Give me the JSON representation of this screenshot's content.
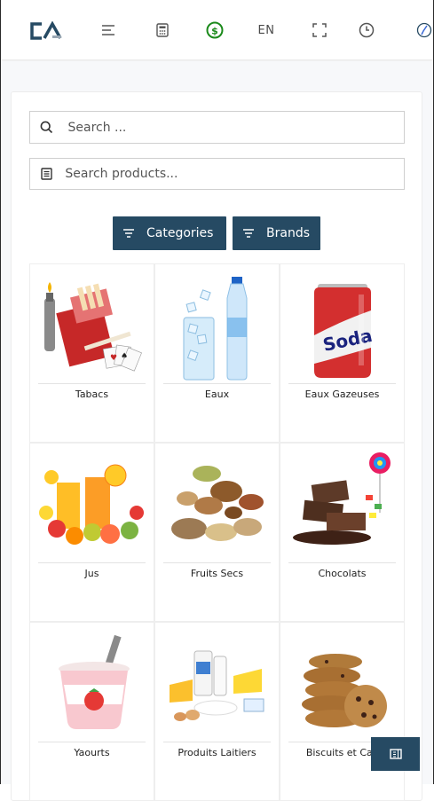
{
  "header": {
    "logo_text": "CA",
    "icons": [
      "menu-icon",
      "calculator-icon",
      "currency-icon",
      "fullscreen-icon",
      "clock-icon",
      "compass-icon"
    ],
    "language": "EN",
    "currency_color": "#1b8a1b"
  },
  "search": {
    "main_placeholder": "Search ...",
    "products_placeholder": "Search products..."
  },
  "filters": {
    "categories_label": "Categories",
    "brands_label": "Brands",
    "button_color": "#264a63"
  },
  "categories": [
    {
      "label": "Tabacs"
    },
    {
      "label": "Eaux"
    },
    {
      "label": "Eaux Gazeuses"
    },
    {
      "label": "Jus"
    },
    {
      "label": "Fruits Secs"
    },
    {
      "label": "Chocolats"
    },
    {
      "label": "Yaourts"
    },
    {
      "label": "Produits Laitiers"
    },
    {
      "label": "Biscuits et Cak"
    }
  ]
}
